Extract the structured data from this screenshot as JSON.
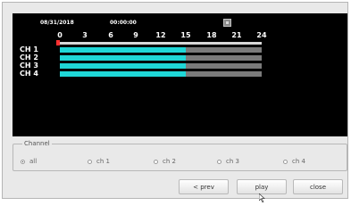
{
  "timeline": {
    "date": "08/31/2018",
    "time": "00:00:00",
    "hour_labels": [
      "0",
      "3",
      "6",
      "9",
      "12",
      "15",
      "18",
      "21",
      "24"
    ],
    "hour_range": [
      0,
      24
    ],
    "channels": [
      {
        "label": "CH 1",
        "recorded_until_hour": 15
      },
      {
        "label": "CH 2",
        "recorded_until_hour": 15
      },
      {
        "label": "CH 3",
        "recorded_until_hour": 15
      },
      {
        "label": "CH 4",
        "recorded_until_hour": 15
      }
    ],
    "colors": {
      "background": "#000000",
      "recorded": "#1fd7d7",
      "empty": "#7a7a7a",
      "cursor": "#ff3030"
    }
  },
  "channel_select": {
    "title": "Channel",
    "options": [
      "all",
      "ch 1",
      "ch 2",
      "ch 3",
      "ch 4"
    ],
    "selected": "all"
  },
  "buttons": {
    "prev": "< prev",
    "play": "play",
    "close": "close"
  }
}
